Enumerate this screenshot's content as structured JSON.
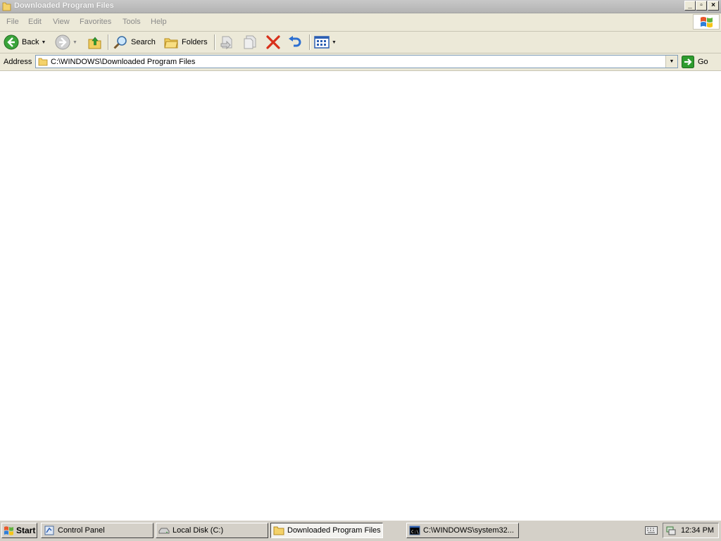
{
  "window": {
    "title": "Downloaded Program Files",
    "controls": [
      "minimize",
      "restore",
      "close"
    ]
  },
  "menu": {
    "items": [
      {
        "label": "File"
      },
      {
        "label": "Edit"
      },
      {
        "label": "View"
      },
      {
        "label": "Favorites"
      },
      {
        "label": "Tools"
      },
      {
        "label": "Help"
      }
    ]
  },
  "toolbar": {
    "back_label": "Back",
    "search_label": "Search",
    "folders_label": "Folders"
  },
  "address": {
    "label": "Address",
    "value": "C:\\WINDOWS\\Downloaded Program Files",
    "go_label": "Go"
  },
  "taskbar": {
    "start_label": "Start",
    "tasks": [
      {
        "label": "Control Panel",
        "icon": "control-panel-icon"
      },
      {
        "label": "Local Disk (C:)",
        "icon": "drive-icon"
      },
      {
        "label": "Downloaded Program Files",
        "icon": "folder-icon",
        "active": true
      },
      {
        "label": "C:\\WINDOWS\\system32...",
        "icon": "console-icon"
      }
    ],
    "clock": "12:34 PM"
  },
  "colors": {
    "chrome": "#ece9d8",
    "taskbar": "#d4d0c8",
    "titlebar": "#b8b8b8",
    "go_green": "#2e9c2e"
  }
}
